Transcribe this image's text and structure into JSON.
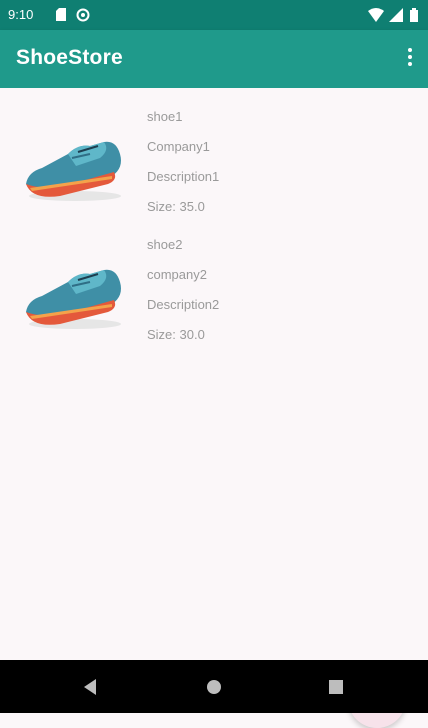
{
  "status_bar": {
    "time": "9:10",
    "icons": [
      "sim-card-icon",
      "data-saver-icon",
      "wifi-icon",
      "cellular-signal-icon",
      "battery-icon"
    ]
  },
  "app_bar": {
    "title": "ShoeStore",
    "overflow_icon": "more-vert-icon",
    "color": "#1f9a8b"
  },
  "shoes": [
    {
      "name": "shoe1",
      "company": "Company1",
      "description": "Description1",
      "size": "Size: 35.0"
    },
    {
      "name": "shoe2",
      "company": "company2",
      "description": "Description2",
      "size": "Size: 30.0"
    }
  ],
  "fab": {
    "icon": "add-icon"
  },
  "nav_bar": {
    "icons": [
      "back-icon",
      "home-icon",
      "recents-icon"
    ]
  }
}
